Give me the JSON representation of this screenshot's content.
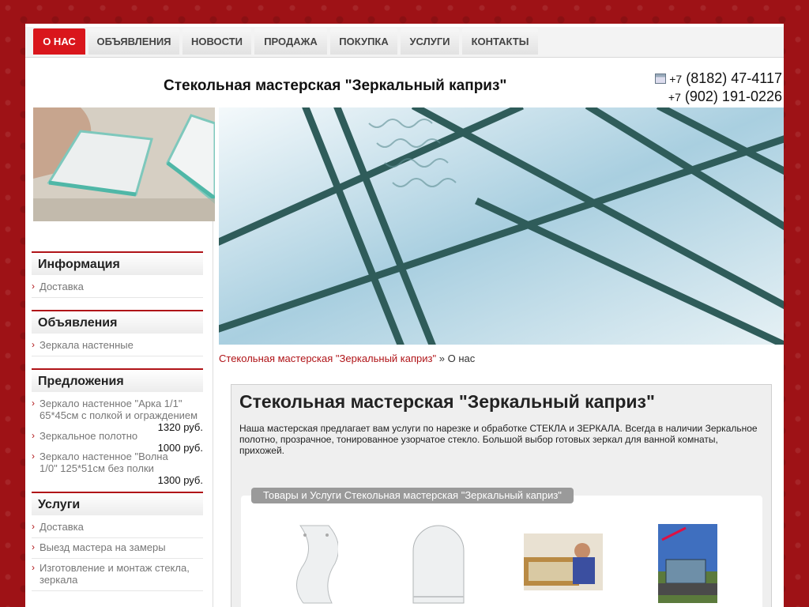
{
  "nav": [
    {
      "label": "О НАС",
      "active": true
    },
    {
      "label": "ОБЪЯВЛЕНИЯ"
    },
    {
      "label": "НОВОСТИ"
    },
    {
      "label": "ПРОДАЖА"
    },
    {
      "label": "ПОКУПКА"
    },
    {
      "label": "УСЛУГИ"
    },
    {
      "label": "КОНТАКТЫ"
    }
  ],
  "header": {
    "title": "Стекольная мастерская \"Зеркальный каприз\"",
    "phones": [
      {
        "code": "+7",
        "number": "(8182) 47-4117"
      },
      {
        "code": "+7",
        "number": "(902) 191-0226"
      }
    ]
  },
  "sidebar": {
    "info": {
      "title": "Информация",
      "items": [
        "Доставка"
      ]
    },
    "ads": {
      "title": "Объявления",
      "items": [
        "Зеркала настенные"
      ]
    },
    "offers": {
      "title": "Предложения",
      "items": [
        {
          "name": "Зеркало настенное \"Арка 1/1\" 65*45см с полкой и ограждением",
          "price": "1320 руб."
        },
        {
          "name": "Зеркальное полотно",
          "price": "1000 руб."
        },
        {
          "name": "Зеркало настенное \"Волна 1/0\" 125*51см без полки",
          "price": "1300 руб."
        }
      ]
    },
    "services": {
      "title": "Услуги",
      "items": [
        "Доставка",
        "Выезд мастера на замеры",
        "Изготовление и монтаж стекла, зеркала"
      ]
    }
  },
  "breadcrumb": {
    "link": "Стекольная мастерская \"Зеркальный каприз\"",
    "separator": "»",
    "current": "О нас"
  },
  "content": {
    "heading": "Стекольная мастерская \"Зеркальный каприз\"",
    "description": "Наша мастерская предлагает вам услуги по нарезке и обработке СТЕКЛА и ЗЕРКАЛА. Всегда в наличии Зеркальное полотно, прозрачное, тонированное узорчатое стекло. Большой выбор готовых зеркал для ванной комнаты, прихожей.",
    "goods_title": "Товары и Услуги Стекольная мастерская \"Зеркальный каприз\""
  },
  "colors": {
    "accent": "#d9161c",
    "link": "#b01418",
    "background": "#9e1216"
  }
}
